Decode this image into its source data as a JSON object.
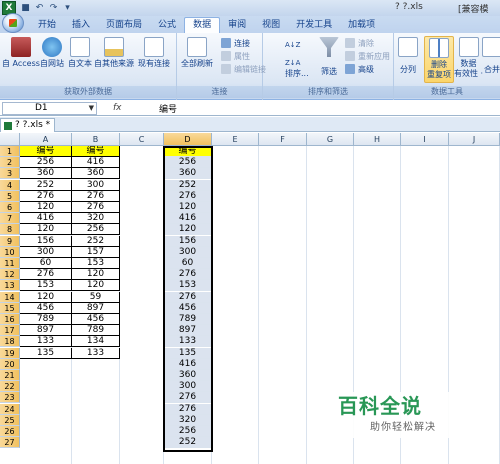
{
  "window": {
    "title": "? ?.xls",
    "app_suffix": "[兼容模"
  },
  "ribbon_tabs": [
    "开始",
    "插入",
    "页面布局",
    "公式",
    "数据",
    "审阅",
    "视图",
    "开发工具",
    "加载项"
  ],
  "active_tab": "数据",
  "ribbon": {
    "get_external": {
      "label": "获取外部数据",
      "buttons": [
        "自 Access",
        "自网站",
        "自文本",
        "自其他来源",
        "现有连接"
      ]
    },
    "connections": {
      "label": "连接",
      "refresh_all": "全部刷新",
      "items": [
        "连接",
        "属性",
        "编辑链接"
      ]
    },
    "sort_filter": {
      "label": "排序和筛选",
      "sort": "排序...",
      "filter": "筛选",
      "items": [
        "清除",
        "重新应用",
        "高级"
      ]
    },
    "data_tools": {
      "label": "数据工具",
      "split": "分列",
      "remove_dup_line1": "删除",
      "remove_dup_line2": "重复项",
      "validation_line1": "数据",
      "validation_line2": "有效性 ·",
      "merge": "合并"
    }
  },
  "formula_bar": {
    "name_box": "D1",
    "fx": "fx",
    "value": "编号"
  },
  "document_tab": "? ?.xls *",
  "columns": [
    "A",
    "B",
    "C",
    "D",
    "E",
    "F",
    "G",
    "H",
    "I",
    "J"
  ],
  "rows": [
    "1",
    "2",
    "3",
    "4",
    "5",
    "6",
    "7",
    "8",
    "9",
    "10",
    "11",
    "12",
    "13",
    "14",
    "15",
    "16",
    "17",
    "18",
    "19",
    "20",
    "21",
    "22",
    "23",
    "24",
    "25",
    "26",
    "27"
  ],
  "col_a": [
    "编号",
    "256",
    "360",
    "252",
    "276",
    "120",
    "416",
    "120",
    "156",
    "300",
    "60",
    "276",
    "153",
    "120",
    "456",
    "789",
    "897",
    "133",
    "135"
  ],
  "col_b": [
    "编号",
    "416",
    "360",
    "300",
    "276",
    "276",
    "320",
    "256",
    "252",
    "157",
    "153",
    "120",
    "120",
    "59",
    "897",
    "456",
    "789",
    "134",
    "133"
  ],
  "col_d": [
    "编号",
    "256",
    "360",
    "252",
    "276",
    "120",
    "416",
    "120",
    "156",
    "300",
    "60",
    "276",
    "153",
    "276",
    "456",
    "789",
    "897",
    "133",
    "135",
    "416",
    "360",
    "300",
    "276",
    "276",
    "320",
    "256",
    "252"
  ],
  "watermark": {
    "title": "百科全说",
    "subtitle": "助你轻松解决"
  }
}
